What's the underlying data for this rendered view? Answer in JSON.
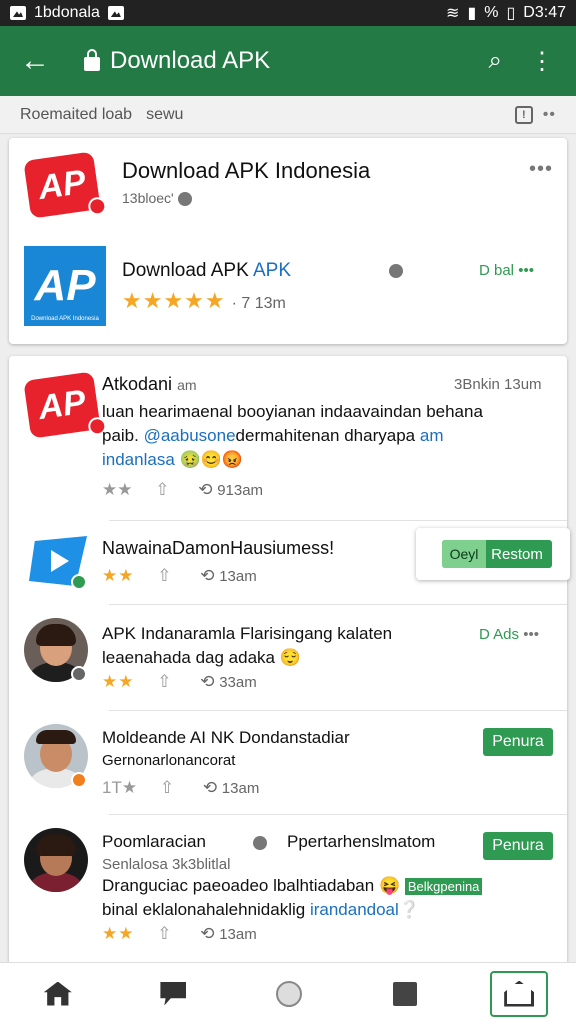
{
  "status_bar": {
    "carrier": "1bdonala",
    "battery": "%",
    "time": "D3:47"
  },
  "app_bar": {
    "title": "Download APK"
  },
  "sub_bar": {
    "left_text": "Roemaited loab",
    "view_label": "sewu"
  },
  "app_card": {
    "title": "Download APK Indonesia",
    "subtitle": "13bloec'",
    "logo_text": "AP",
    "featured": {
      "name_black": "Download APK",
      "name_blue": "APK",
      "stars": "★★★★★",
      "meta": "· 7 13m",
      "action": "D bal",
      "logo_text": "AP"
    }
  },
  "feed": [
    {
      "name": "Atkodani",
      "handle": "am",
      "time": "3Bnkin 13um",
      "line1": "luan hearimaenal booyianan indaavaindan behana",
      "line2_pre": "paib. ",
      "line2_mention": "@aabusone",
      "line2_post": "dermahitenan dharyapa",
      "line2_tail": "am",
      "line3": "indanlasa",
      "emoji": "🤢😊😡",
      "actions_stars": "★★",
      "reshare": "913am",
      "logo_text": "AP"
    },
    {
      "name": "NawainaDamonHausiumess!",
      "actions_stars": "★★",
      "reshare": "13am",
      "restore_lead": "Oeyl",
      "restore_label": "Restom"
    },
    {
      "name": "APK Indanaramla Flarisingang kalaten",
      "line2": "leaenahada dag adaka",
      "emoji": "😌",
      "action": "D Ads",
      "actions_stars": "★★",
      "reshare": "33am"
    },
    {
      "name": "Moldeande AI NK Dondanstadiar",
      "line2": "Gernonarlonancorat",
      "button": "Penura",
      "actions_stars": "1T★",
      "reshare": "13am"
    },
    {
      "name": "Poomlaracian",
      "name_right": "Ppertarhenslmatom",
      "line2": "Senlalosa 3k3blitlal",
      "line3": "Dranguciac paeoadeo lbalhtiadaban",
      "emoji": "😝",
      "tag": "Belkgpenina",
      "line4_pre": "binal eklalonahalehnidaklig ",
      "line4_link": "irandandoal",
      "line4_emoji": "❔",
      "button": "Penura",
      "actions_stars": "★★",
      "reshare": "13am"
    }
  ],
  "colors": {
    "primary": "#237a45",
    "accent": "#2f9a52",
    "star": "#f5a623",
    "brand_red": "#e8222d",
    "brand_blue": "#1a86d6"
  }
}
